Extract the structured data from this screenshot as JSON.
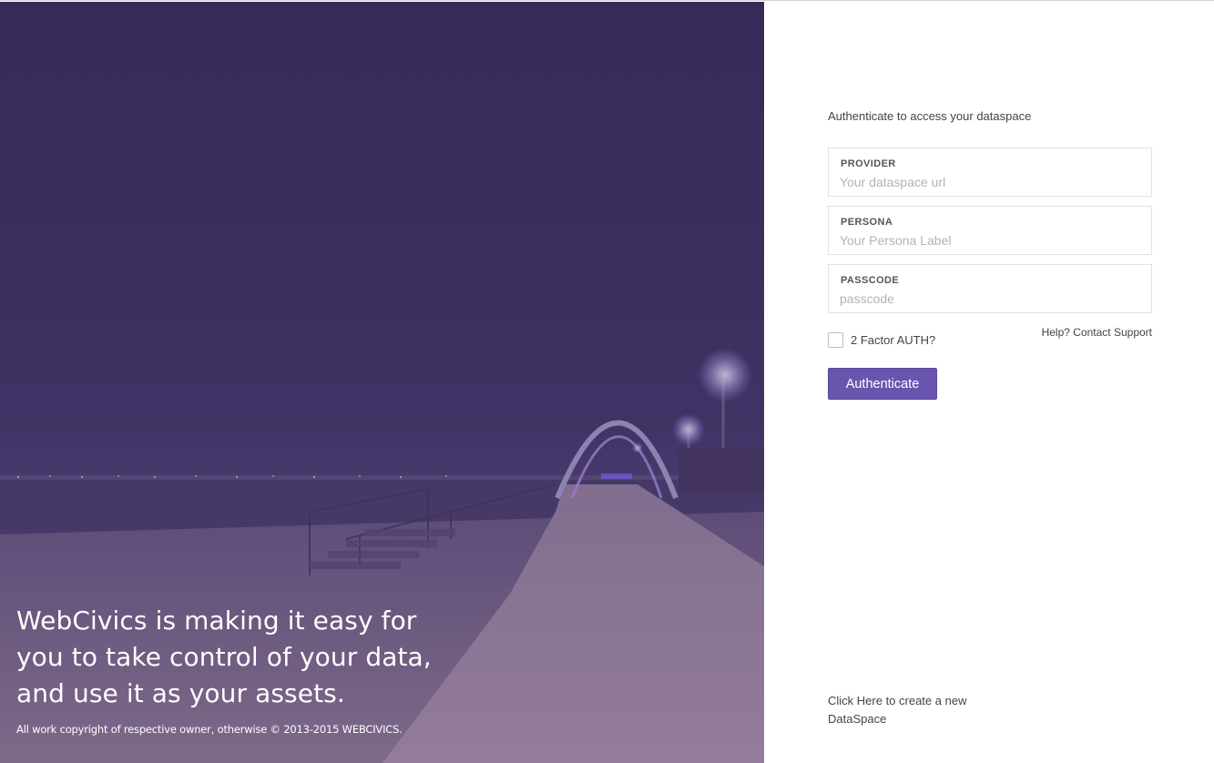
{
  "hero": {
    "tagline": "WebCivics is making it easy for you to take control of your data, and use it as your assets.",
    "copyright": "All work copyright of respective owner, otherwise © 2013-2015 WEBCIVICS."
  },
  "form": {
    "intro": "Authenticate to access your dataspace",
    "provider": {
      "label": "PROVIDER",
      "placeholder": "Your dataspace url",
      "value": ""
    },
    "persona": {
      "label": "PERSONA",
      "placeholder": "Your Persona Label",
      "value": ""
    },
    "passcode": {
      "label": "PASSCODE",
      "placeholder": "passcode",
      "value": ""
    },
    "two_factor": {
      "label": "2 Factor AUTH?",
      "checked": false
    },
    "help_link": "Help? Contact Support",
    "submit_label": "Authenticate",
    "create_link": "Click Here to create a new DataSpace"
  },
  "colors": {
    "accent": "#6a55ae",
    "hero_tint": "#48347a"
  }
}
